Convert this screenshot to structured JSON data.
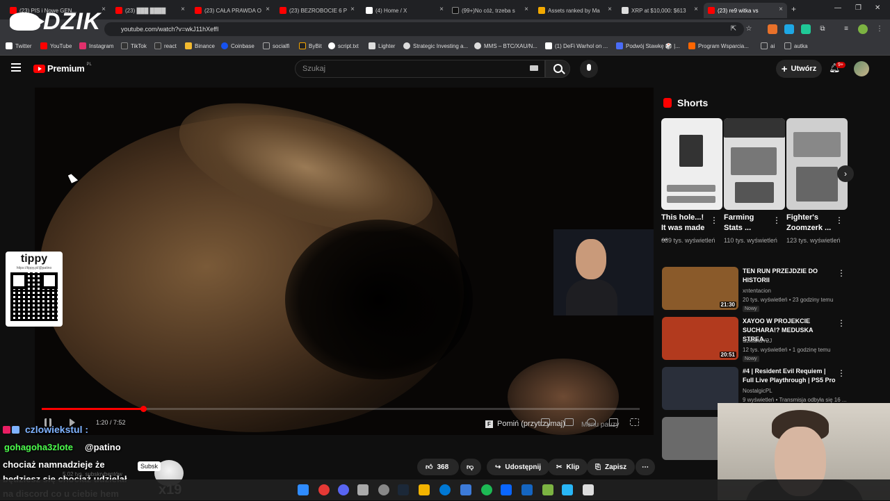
{
  "browser": {
    "tabs": [
      {
        "label": "(23) PIS i Nowe GEN...",
        "fav": "#ff0000"
      },
      {
        "label": "(23) ███ ████",
        "fav": "#ff0000"
      },
      {
        "label": "(23) CAŁA PRAWDA O",
        "fav": "#ff0000"
      },
      {
        "label": "(23) BEZROBOCIE 6 P",
        "fav": "#ff0000"
      },
      {
        "label": "(4) Home / X",
        "fav": "#ffffff"
      },
      {
        "label": "(99+)No cóż, trzeba s",
        "fav": "#111111"
      },
      {
        "label": "Assets ranked by Ma",
        "fav": "#f2a900"
      },
      {
        "label": "XRP at $10,000: $613",
        "fav": "#dddddd"
      },
      {
        "label": "(23) re9 witka vs",
        "fav": "#ff0000"
      }
    ],
    "new_tab": "+",
    "url": "youtube.com/watch?v=wkJ11hXeffI",
    "bookmarks": [
      {
        "label": "Twitter",
        "color": "#ffffff"
      },
      {
        "label": "YouTube",
        "color": "#ff0000"
      },
      {
        "label": "Instagram",
        "color": "#e1306c"
      },
      {
        "label": "TikTok",
        "color": "#ffffff"
      },
      {
        "label": "react",
        "color": "#ffffff"
      },
      {
        "label": "Binance",
        "color": "#f3ba2f"
      },
      {
        "label": "Coinbase",
        "color": "#1652f0"
      },
      {
        "label": "socialfi",
        "color": "#aaaaaa"
      },
      {
        "label": "ByBit",
        "color": "#f7a600"
      },
      {
        "label": "script.txt",
        "color": "#ffffff"
      },
      {
        "label": "Lighter",
        "color": "#ffffff"
      },
      {
        "label": "Strategic Investing a...",
        "color": "#ffffff"
      },
      {
        "label": "MMS – BTC/XAU/N...",
        "color": "#ffffff"
      },
      {
        "label": "(1) DeFi Warhol on ...",
        "color": "#ffffff"
      },
      {
        "label": "Podwój Stawkę 🎲 |...",
        "color": "#4a6cf7"
      },
      {
        "label": "Program Wsparcia...",
        "color": "#ff6600"
      },
      {
        "label": "ai",
        "color": "#aaaaaa"
      },
      {
        "label": "autka",
        "color": "#aaaaaa"
      }
    ]
  },
  "overlay": {
    "logo": "DZIK",
    "tippy_title": "tippy",
    "tippy_url": "https://tippy.pl/@patino",
    "chat_user1": "czlowiekstul :",
    "chat_user2": "gohagoha3zlote",
    "chat_mention": "@patino",
    "chat_message": "chociaż namnadzieje że będziesz się chociaż udzielał na discord co u ciebie hem",
    "subs_badge": "Subsk",
    "combo": "x19"
  },
  "youtube": {
    "logo_word": "Premium",
    "logo_region": "PL",
    "search_placeholder": "Szukaj",
    "create_label": "Utwórz",
    "notif_count": "9+",
    "player": {
      "time": "1:20 / 7:52",
      "progress": 0.17,
      "skip_label": "Pomiń (przytrzymaj)",
      "pause_menu": "Menu pauzy"
    },
    "channel_subs": "5,02 tys. subskrybentów",
    "actions": {
      "likes": "368",
      "share": "Udostępnij",
      "clip": "Klip",
      "save": "Zapisz"
    },
    "shorts_title": "Shorts",
    "shorts": [
      {
        "title": "This hole...! It was made ...",
        "views": "689 tys. wyświetleń"
      },
      {
        "title": "Farming Stats ...",
        "views": "110 tys. wyświetleń"
      },
      {
        "title": "Fighter's Zoomzerk ...",
        "views": "123 tys. wyświetleń"
      }
    ],
    "recommendations": [
      {
        "title": "TEN RUN PRZEJDZIE DO HISTORII",
        "channel": "xntentacion",
        "meta": "20 tys. wyświetleń • 23 godziny temu",
        "badge": "Nowy",
        "duration": "21:30",
        "thumb": "#8a5a2a"
      },
      {
        "title": "XAYOO W PROJEKCIE SUCHARA!? MEDUSKA STREA...",
        "channel": "SzklanaY2J",
        "meta": "12 tys. wyświetleń • 1 godzinę temu",
        "badge": "Nowy",
        "duration": "20:51",
        "thumb": "#b23a1e"
      },
      {
        "title": "#4 | Resident Evil Requiem | Full Live Playthrough | PS5 Pro",
        "channel": "NostalgicPL",
        "meta": "9 wyświetleń • Transmisja odbyła się 16 ...",
        "badge": "",
        "duration": "",
        "thumb": "#2a2f3a"
      },
      {
        "title": "",
        "channel": "",
        "meta": "",
        "badge": "",
        "duration": "",
        "thumb": "#6a6a6a"
      }
    ]
  }
}
